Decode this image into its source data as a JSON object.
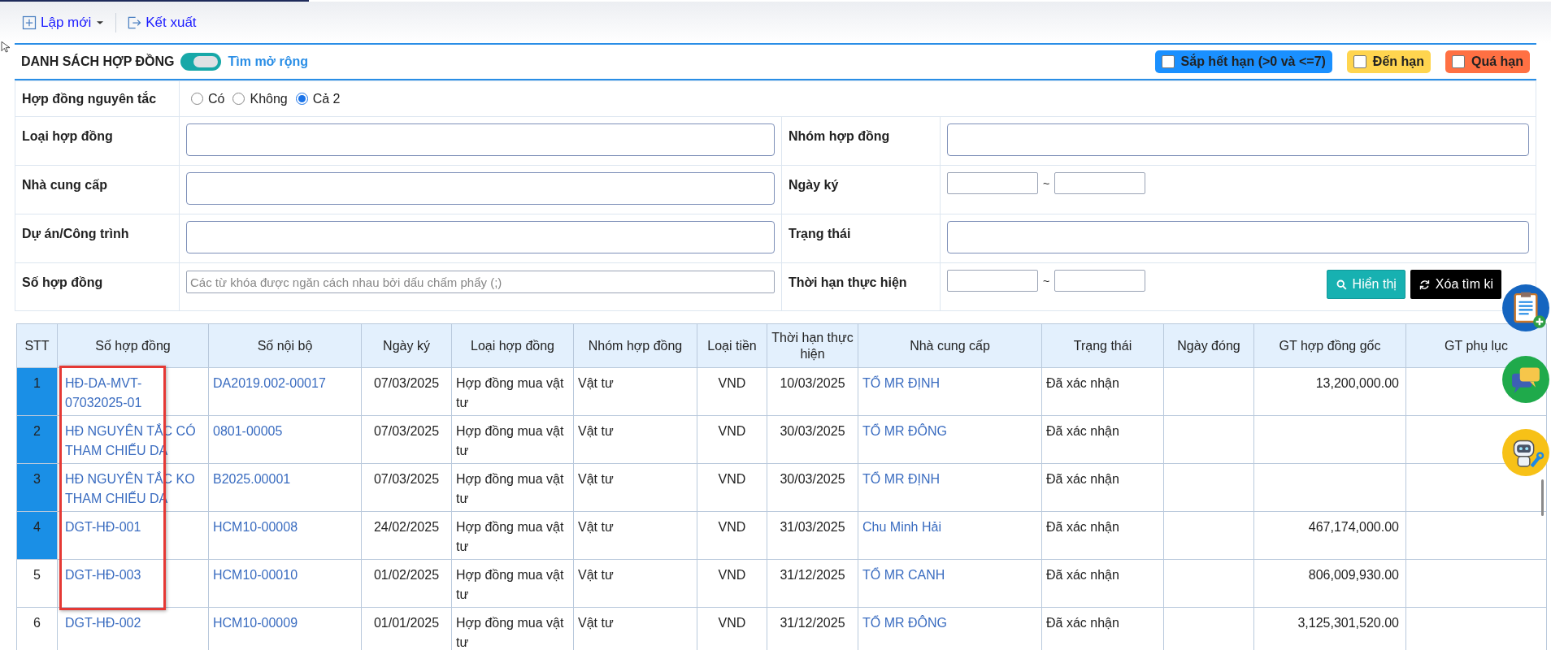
{
  "toolbar": [
    {
      "label": "Lập mới",
      "dropdown": true
    },
    {
      "label": "Kết xuất",
      "dropdown": false
    }
  ],
  "panel": {
    "title": "DANH SÁCH HỢP ĐỒNG",
    "toggle": {
      "on": true
    },
    "toggle_label": "Tìm mở rộng",
    "legend": [
      {
        "label": "Sắp hết hạn (>0 và <=7)",
        "color": "#1a90ff",
        "checked": false
      },
      {
        "label": "Đến hạn",
        "color": "#ffd54f",
        "checked": false
      },
      {
        "label": "Quá hạn",
        "color": "#ff7043",
        "checked": false
      }
    ]
  },
  "filters": {
    "principle": {
      "label": "Hợp đồng nguyên tắc",
      "options": [
        {
          "label": "Có",
          "selected": false
        },
        {
          "label": "Không",
          "selected": false
        },
        {
          "label": "Cả 2",
          "selected": true
        }
      ]
    },
    "rows": [
      {
        "left": {
          "label": "Loại hợp đồng",
          "kind": "text"
        },
        "right": {
          "label": "Nhóm hợp đồng",
          "kind": "text"
        }
      },
      {
        "left": {
          "label": "Nhà cung cấp",
          "kind": "text"
        },
        "right": {
          "label": "Ngày ký",
          "kind": "range",
          "separator": "~"
        }
      },
      {
        "left": {
          "label": "Dự án/Công trình",
          "kind": "text"
        },
        "right": {
          "label": "Trạng thái",
          "kind": "text"
        }
      },
      {
        "left": {
          "label": "Số hợp đồng",
          "kind": "keywords",
          "placeholder": "Các từ khóa được ngăn cách nhau bởi dấu chấm phẩy (;)"
        },
        "right": {
          "label": "Thời hạn thực hiện",
          "kind": "range",
          "separator": "~"
        }
      }
    ],
    "buttons": [
      {
        "label": "Hiển thị",
        "kind": "search"
      },
      {
        "label": "Xóa tìm ki",
        "kind": "reset"
      }
    ]
  },
  "table": {
    "columns": [
      "STT",
      "Số hợp đồng",
      "Số nội bộ",
      "Ngày ký",
      "Loại hợp đồng",
      "Nhóm hợp đồng",
      "Loại tiền",
      "Thời hạn thực hiện",
      "Nhà cung cấp",
      "Trạng thái",
      "Ngày đóng",
      "GT hợp đồng gốc",
      "GT phụ lục"
    ],
    "rows": [
      {
        "stt": "1",
        "highlighted": true,
        "so_hop_dong": "HĐ-DA-MVT-07032025-01",
        "so_noi_bo": "DA2019.002-00017",
        "ngay_ky": "07/03/2025",
        "loai": "Hợp đồng mua vật tư",
        "nhom": "Vật tư",
        "loai_tien": "VND",
        "thoi_han": "10/03/2025",
        "nha_cung_cap": "TỔ MR ĐỊNH",
        "trang_thai": "Đã xác nhận",
        "gt_goc": "13,200,000.00"
      },
      {
        "stt": "2",
        "highlighted": true,
        "so_hop_dong": "HĐ NGUYÊN TẮC CÓ THAM CHIẾU DA",
        "so_noi_bo": "0801-00005",
        "ngay_ky": "07/03/2025",
        "loai": "Hợp đồng mua vật tư",
        "nhom": "Vật tư",
        "loai_tien": "VND",
        "thoi_han": "30/03/2025",
        "nha_cung_cap": "TỔ MR ĐÔNG",
        "trang_thai": "Đã xác nhận"
      },
      {
        "stt": "3",
        "highlighted": true,
        "so_hop_dong": "HĐ NGUYÊN TẮC KO THAM CHIẾU DA",
        "so_noi_bo": "B2025.00001",
        "ngay_ky": "07/03/2025",
        "loai": "Hợp đồng mua vật tư",
        "nhom": "Vật tư",
        "loai_tien": "VND",
        "thoi_han": "30/03/2025",
        "nha_cung_cap": "TỔ MR ĐỊNH",
        "trang_thai": "Đã xác nhận"
      },
      {
        "stt": "4",
        "highlighted": true,
        "so_hop_dong": "DGT-HĐ-001",
        "so_noi_bo": "HCM10-00008",
        "ngay_ky": "24/02/2025",
        "loai": "Hợp đồng mua vật tư",
        "nhom": "Vật tư",
        "loai_tien": "VND",
        "thoi_han": "31/03/2025",
        "nha_cung_cap": "Chu Minh Hải",
        "trang_thai": "Đã xác nhận",
        "gt_goc": "467,174,000.00"
      },
      {
        "stt": "5",
        "highlighted": false,
        "so_hop_dong": "DGT-HĐ-003",
        "so_noi_bo": "HCM10-00010",
        "ngay_ky": "01/02/2025",
        "loai": "Hợp đồng mua vật tư",
        "nhom": "Vật tư",
        "loai_tien": "VND",
        "thoi_han": "31/12/2025",
        "nha_cung_cap": "TỔ MR CANH",
        "trang_thai": "Đã xác nhận",
        "gt_goc": "806,009,930.00"
      },
      {
        "stt": "6",
        "highlighted": false,
        "so_hop_dong": "DGT-HĐ-002",
        "so_noi_bo": "HCM10-00009",
        "ngay_ky": "01/01/2025",
        "loai": "Hợp đồng mua vật tư",
        "nhom": "Vật tư",
        "loai_tien": "VND",
        "thoi_han": "31/12/2025",
        "nha_cung_cap": "TỔ MR ĐÔNG",
        "trang_thai": "Đã xác nhận",
        "gt_goc": "3,125,301,520.00"
      }
    ]
  },
  "annotation_frame": true,
  "floating_buttons": [
    {
      "kind": "clipboard"
    },
    {
      "kind": "chat"
    },
    {
      "kind": "robot"
    }
  ]
}
